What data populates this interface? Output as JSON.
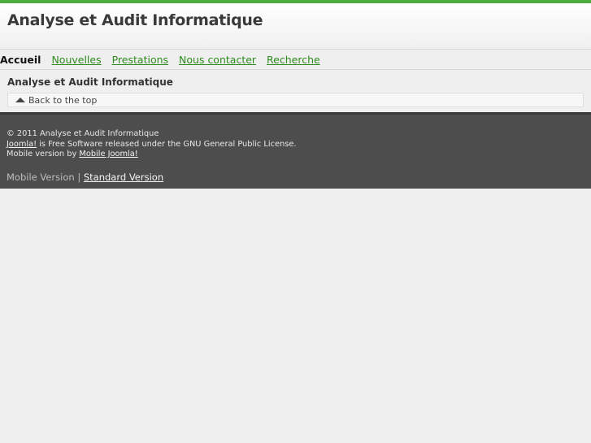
{
  "header": {
    "title": "Analyse et Audit Informatique"
  },
  "nav": {
    "items": [
      {
        "label": "Accueil",
        "active": true
      },
      {
        "label": "Nouvelles"
      },
      {
        "label": "Prestations"
      },
      {
        "label": "Nous contacter"
      },
      {
        "label": "Recherche"
      }
    ]
  },
  "content": {
    "heading": "Analyse et Audit Informatique",
    "back_to_top": "Back to the top"
  },
  "footer": {
    "copyright": "© 2011 Analyse et Audit Informatique",
    "joomla_link": "Joomla!",
    "joomla_text": " is Free Software released under the GNU General Public License.",
    "mobile_by_text": "Mobile version by ",
    "mobile_joomla_link": "Mobile Joomla!",
    "mobile_version": "Mobile Version",
    "separator": " | ",
    "standard_version": "Standard Version"
  },
  "colors": {
    "accent": "#4cae3c",
    "link": "#2f8a1f",
    "footer_bg": "#4d4d4d"
  }
}
